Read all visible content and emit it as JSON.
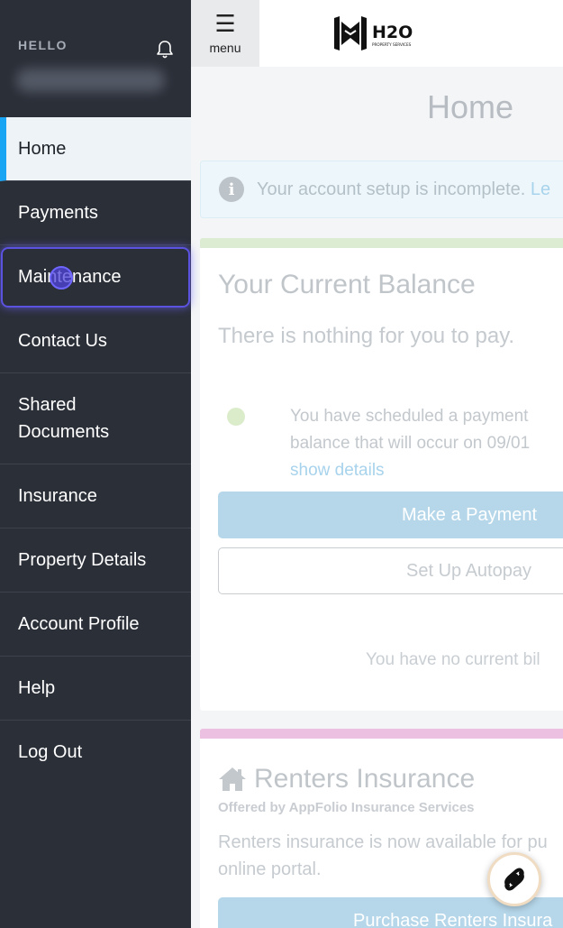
{
  "sidebar": {
    "greeting": "HELLO",
    "items": [
      {
        "label": "Home"
      },
      {
        "label": "Payments"
      },
      {
        "label": "Maintenance"
      },
      {
        "label": "Contact Us"
      },
      {
        "label": "Shared Documents"
      },
      {
        "label": "Insurance"
      },
      {
        "label": "Property Details"
      },
      {
        "label": "Account Profile"
      },
      {
        "label": "Help"
      },
      {
        "label": "Log Out"
      }
    ],
    "active_item": "Home",
    "focused_item": "Maintenance"
  },
  "header": {
    "menu_label": "menu",
    "logo_text": "H2O",
    "logo_subtext": "PROPERTY SERVICES"
  },
  "main": {
    "title": "Home",
    "alert": {
      "text": "Your account setup is incomplete.",
      "link": "Le"
    },
    "balance_card": {
      "title": "Your Current Balance",
      "subtitle": "There is nothing for you to pay.",
      "scheduled_line1": "You have scheduled a payment",
      "scheduled_line2": "balance that will occur on 09/01",
      "show_details": "show details",
      "pay_button": "Make a Payment",
      "autopay_button": "Set Up Autopay",
      "no_bills": "You have no current bil"
    },
    "insurance_card": {
      "title": "Renters Insurance",
      "offered_by": "Offered by AppFolio Insurance Services",
      "text_line1": "Renters insurance is now available for pu",
      "text_line2": "online portal.",
      "button": "Purchase Renters Insura"
    }
  },
  "colors": {
    "sidebar_bg": "#2b2f38",
    "active_accent": "#19a5f4",
    "focus_ring": "#5b52e0",
    "button_primary": "#b6d7ea",
    "balance_bar": "#dcecd2",
    "insurance_bar": "#ecc0e0"
  },
  "icons": {
    "bell": "bell-icon",
    "menu": "hamburger-icon",
    "info": "info-icon",
    "house": "house-icon",
    "chat": "chat-widget-icon"
  }
}
